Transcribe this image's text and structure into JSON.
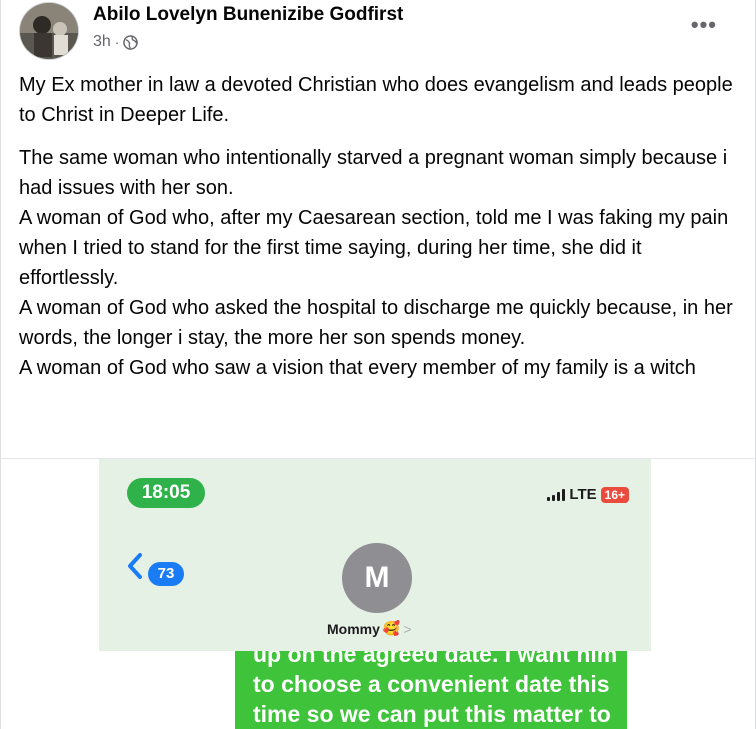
{
  "post": {
    "author": "Abilo Lovelyn Bunenizibe Godfirst",
    "time": "3h",
    "separator": "·",
    "more_label": "•••",
    "paragraph1": "My Ex mother  in law a devoted Christian who does evangelism and leads people to Christ in Deeper Life.",
    "paragraph2": "The same woman who intentionally starved a pregnant woman simply because i had issues with her son.\nA woman of God who, after my Caesarean section, told me I was faking my pain when I tried to stand for the first time saying, during her time, she did it effortlessly.\nA woman of God who asked the hospital to discharge me quickly because, in her words, the longer i stay, the more her  son spends money.\nA  woman of God who saw a vision that every member of my family is a witch"
  },
  "screenshot": {
    "time": "18:05",
    "network": "LTE",
    "battery": "16+",
    "unread_count": "73",
    "contact_initial": "M",
    "contact_name": "Mommy",
    "contact_emoji": "🥰",
    "contact_chevron": ">",
    "message_partial": "up on the agreed date. I want him to choose a convenient date this time so we can put this matter to rest."
  },
  "colors": {
    "green_pill": "#2fb24a",
    "imessage_green": "#3ec33a",
    "badge_blue": "#1a7cf5",
    "secondary_text": "#65676b"
  }
}
